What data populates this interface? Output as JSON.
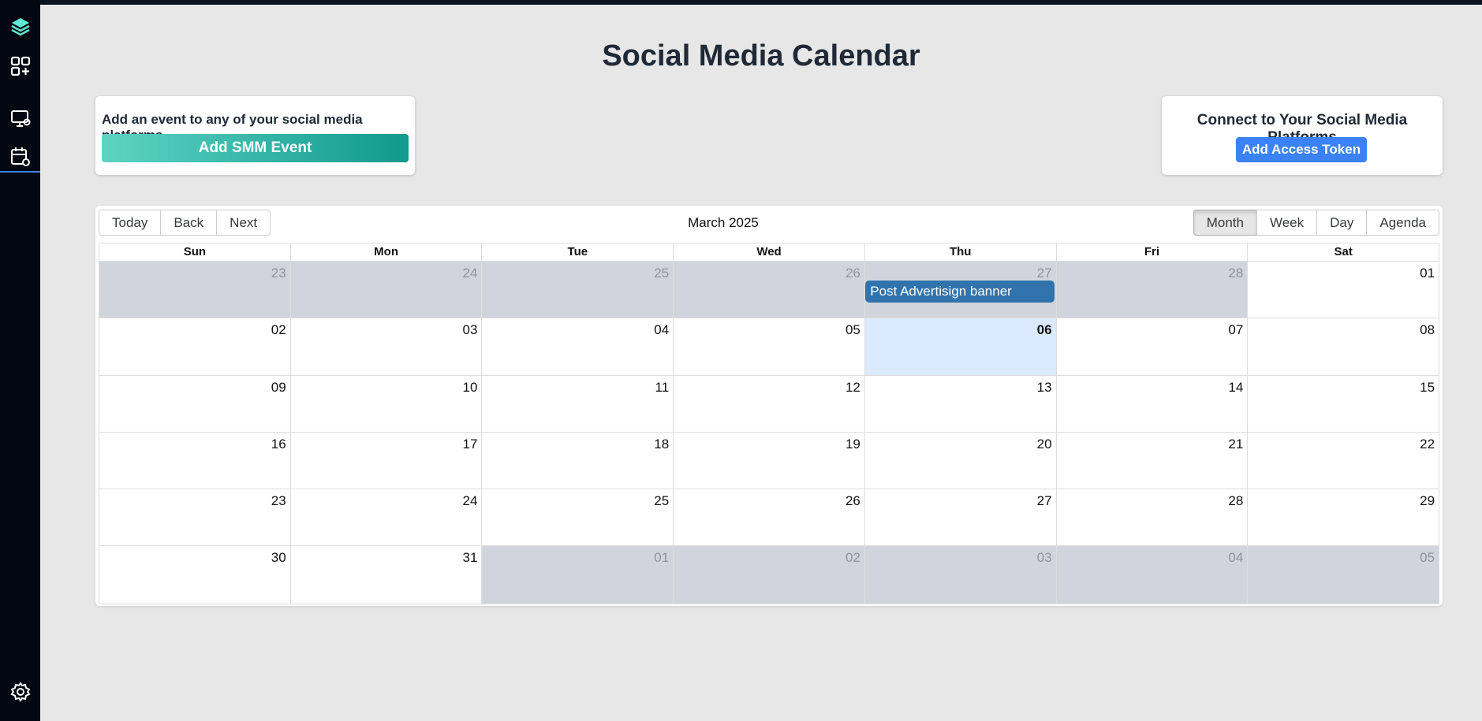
{
  "app": {
    "title": "Social Media Calendar"
  },
  "sidebar": {
    "icons": [
      "logo-icon",
      "apps-add-icon",
      "monitor-settings-icon",
      "calendar-settings-icon",
      "settings-icon"
    ]
  },
  "add_event_card": {
    "text": "Add an event to any of your social media platforms",
    "button_label": "Add SMM Event"
  },
  "connect_card": {
    "text": "Connect to Your Social Media Platforms",
    "button_label": "Add Access Token"
  },
  "toolbar": {
    "today": "Today",
    "back": "Back",
    "next": "Next",
    "label": "March 2025",
    "views": [
      "Month",
      "Week",
      "Day",
      "Agenda"
    ],
    "active_view": "Month"
  },
  "calendar": {
    "weekdays": [
      "Sun",
      "Mon",
      "Tue",
      "Wed",
      "Thu",
      "Fri",
      "Sat"
    ],
    "weeks": [
      [
        {
          "d": "23",
          "off": true
        },
        {
          "d": "24",
          "off": true
        },
        {
          "d": "25",
          "off": true
        },
        {
          "d": "26",
          "off": true
        },
        {
          "d": "27",
          "off": true
        },
        {
          "d": "28",
          "off": true
        },
        {
          "d": "01",
          "off": false
        }
      ],
      [
        {
          "d": "02",
          "off": false
        },
        {
          "d": "03",
          "off": false
        },
        {
          "d": "04",
          "off": false
        },
        {
          "d": "05",
          "off": false
        },
        {
          "d": "06",
          "off": false,
          "today": true
        },
        {
          "d": "07",
          "off": false
        },
        {
          "d": "08",
          "off": false
        }
      ],
      [
        {
          "d": "09",
          "off": false
        },
        {
          "d": "10",
          "off": false
        },
        {
          "d": "11",
          "off": false
        },
        {
          "d": "12",
          "off": false
        },
        {
          "d": "13",
          "off": false
        },
        {
          "d": "14",
          "off": false
        },
        {
          "d": "15",
          "off": false
        }
      ],
      [
        {
          "d": "16",
          "off": false
        },
        {
          "d": "17",
          "off": false
        },
        {
          "d": "18",
          "off": false
        },
        {
          "d": "19",
          "off": false
        },
        {
          "d": "20",
          "off": false
        },
        {
          "d": "21",
          "off": false
        },
        {
          "d": "22",
          "off": false
        }
      ],
      [
        {
          "d": "23",
          "off": false
        },
        {
          "d": "24",
          "off": false
        },
        {
          "d": "25",
          "off": false
        },
        {
          "d": "26",
          "off": false
        },
        {
          "d": "27",
          "off": false
        },
        {
          "d": "28",
          "off": false
        },
        {
          "d": "29",
          "off": false
        }
      ],
      [
        {
          "d": "30",
          "off": false
        },
        {
          "d": "31",
          "off": false
        },
        {
          "d": "01",
          "off": true
        },
        {
          "d": "02",
          "off": true
        },
        {
          "d": "03",
          "off": true
        },
        {
          "d": "04",
          "off": true
        },
        {
          "d": "05",
          "off": true
        }
      ]
    ],
    "events": [
      {
        "title": "Post Advertisign banner",
        "week": 0,
        "day": 4
      }
    ]
  },
  "colors": {
    "event": "#3174ad",
    "today_bg": "#dbeafe",
    "off_range_bg": "#d1d5db",
    "primary_button": "#3b82f6"
  }
}
